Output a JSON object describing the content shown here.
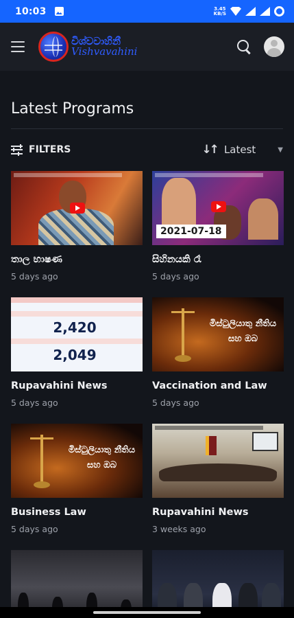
{
  "status_bar": {
    "time": "10:03",
    "net_speed_value": "3.45",
    "net_speed_unit": "KB/S"
  },
  "app_bar": {
    "logo_text_sinhala": "විශ්වවාහිනී",
    "logo_text_latin": "Vishvavahini"
  },
  "page": {
    "title": "Latest Programs"
  },
  "filters": {
    "label": "FILTERS",
    "sort_selected": "Latest"
  },
  "programs": [
    {
      "title": "තාල භාෂණ",
      "date": "5 days ago"
    },
    {
      "title": "සිහිනයකි රෑ",
      "date": "5 days ago",
      "thumb_date": "2021-07-18"
    },
    {
      "title": "Rupavahini News",
      "date": "5 days ago",
      "thumb_lines": [
        "2,420",
        "2,049"
      ]
    },
    {
      "title": "Vaccination and Law",
      "date": "5 days ago",
      "thumb_lines": [
        "මිස්ටුලියාතු නීතිය",
        "සහ ඔබ"
      ]
    },
    {
      "title": "Business Law",
      "date": "5 days ago",
      "thumb_lines": [
        "මිස්ටුලියාතු නීතිය",
        "සහ ඔබ"
      ]
    },
    {
      "title": "Rupavahini News",
      "date": "3 weeks ago"
    },
    {
      "title": "",
      "date": ""
    },
    {
      "title": "",
      "date": ""
    }
  ]
}
